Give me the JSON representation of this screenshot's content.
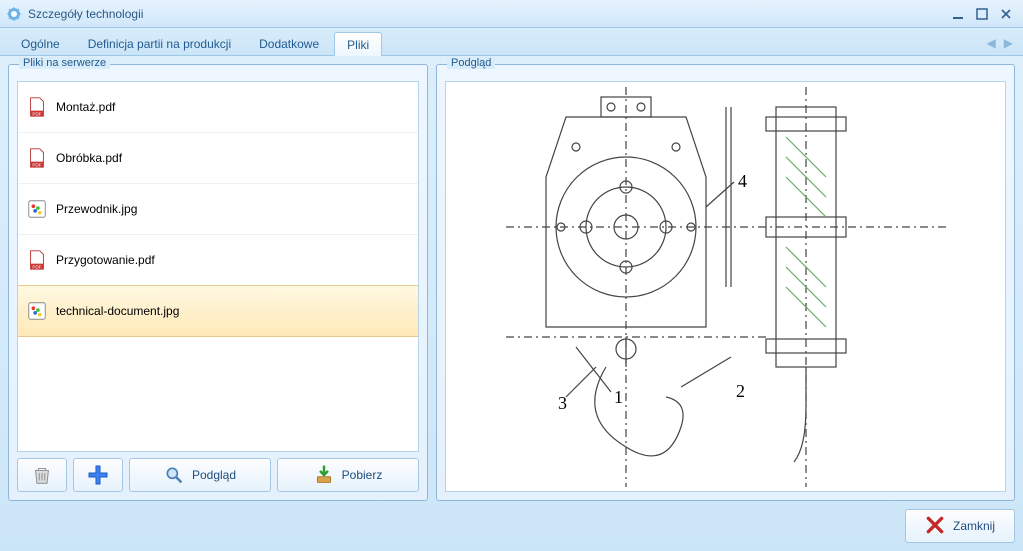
{
  "window": {
    "title": "Szczegóły technologii"
  },
  "tabs": {
    "items": [
      {
        "label": "Ogólne"
      },
      {
        "label": "Definicja partii na produkcji"
      },
      {
        "label": "Dodatkowe"
      },
      {
        "label": "Pliki"
      }
    ],
    "active_index": 3
  },
  "left_panel": {
    "legend": "Pliki na serwerze",
    "files": [
      {
        "name": "Montaż.pdf",
        "type": "pdf",
        "selected": false
      },
      {
        "name": "Obróbka.pdf",
        "type": "pdf",
        "selected": false
      },
      {
        "name": "Przewodnik.jpg",
        "type": "jpg",
        "selected": false
      },
      {
        "name": "Przygotowanie.pdf",
        "type": "pdf",
        "selected": false
      },
      {
        "name": "technical-document.jpg",
        "type": "jpg",
        "selected": true
      }
    ],
    "buttons": {
      "delete": {
        "icon": "trash-icon"
      },
      "add": {
        "icon": "plus-icon"
      },
      "preview": {
        "icon": "magnifier-icon",
        "label": "Podgląd"
      },
      "download": {
        "icon": "download-icon",
        "label": "Pobierz"
      }
    }
  },
  "right_panel": {
    "legend": "Podgląd",
    "preview_labels": [
      "1",
      "2",
      "3",
      "4"
    ]
  },
  "footer": {
    "close": {
      "icon": "close-x-icon",
      "label": "Zamknij"
    }
  },
  "colors": {
    "accent": "#2a5885",
    "panel_border": "#8fb7db",
    "selection_bg": "#ffe9b8"
  }
}
